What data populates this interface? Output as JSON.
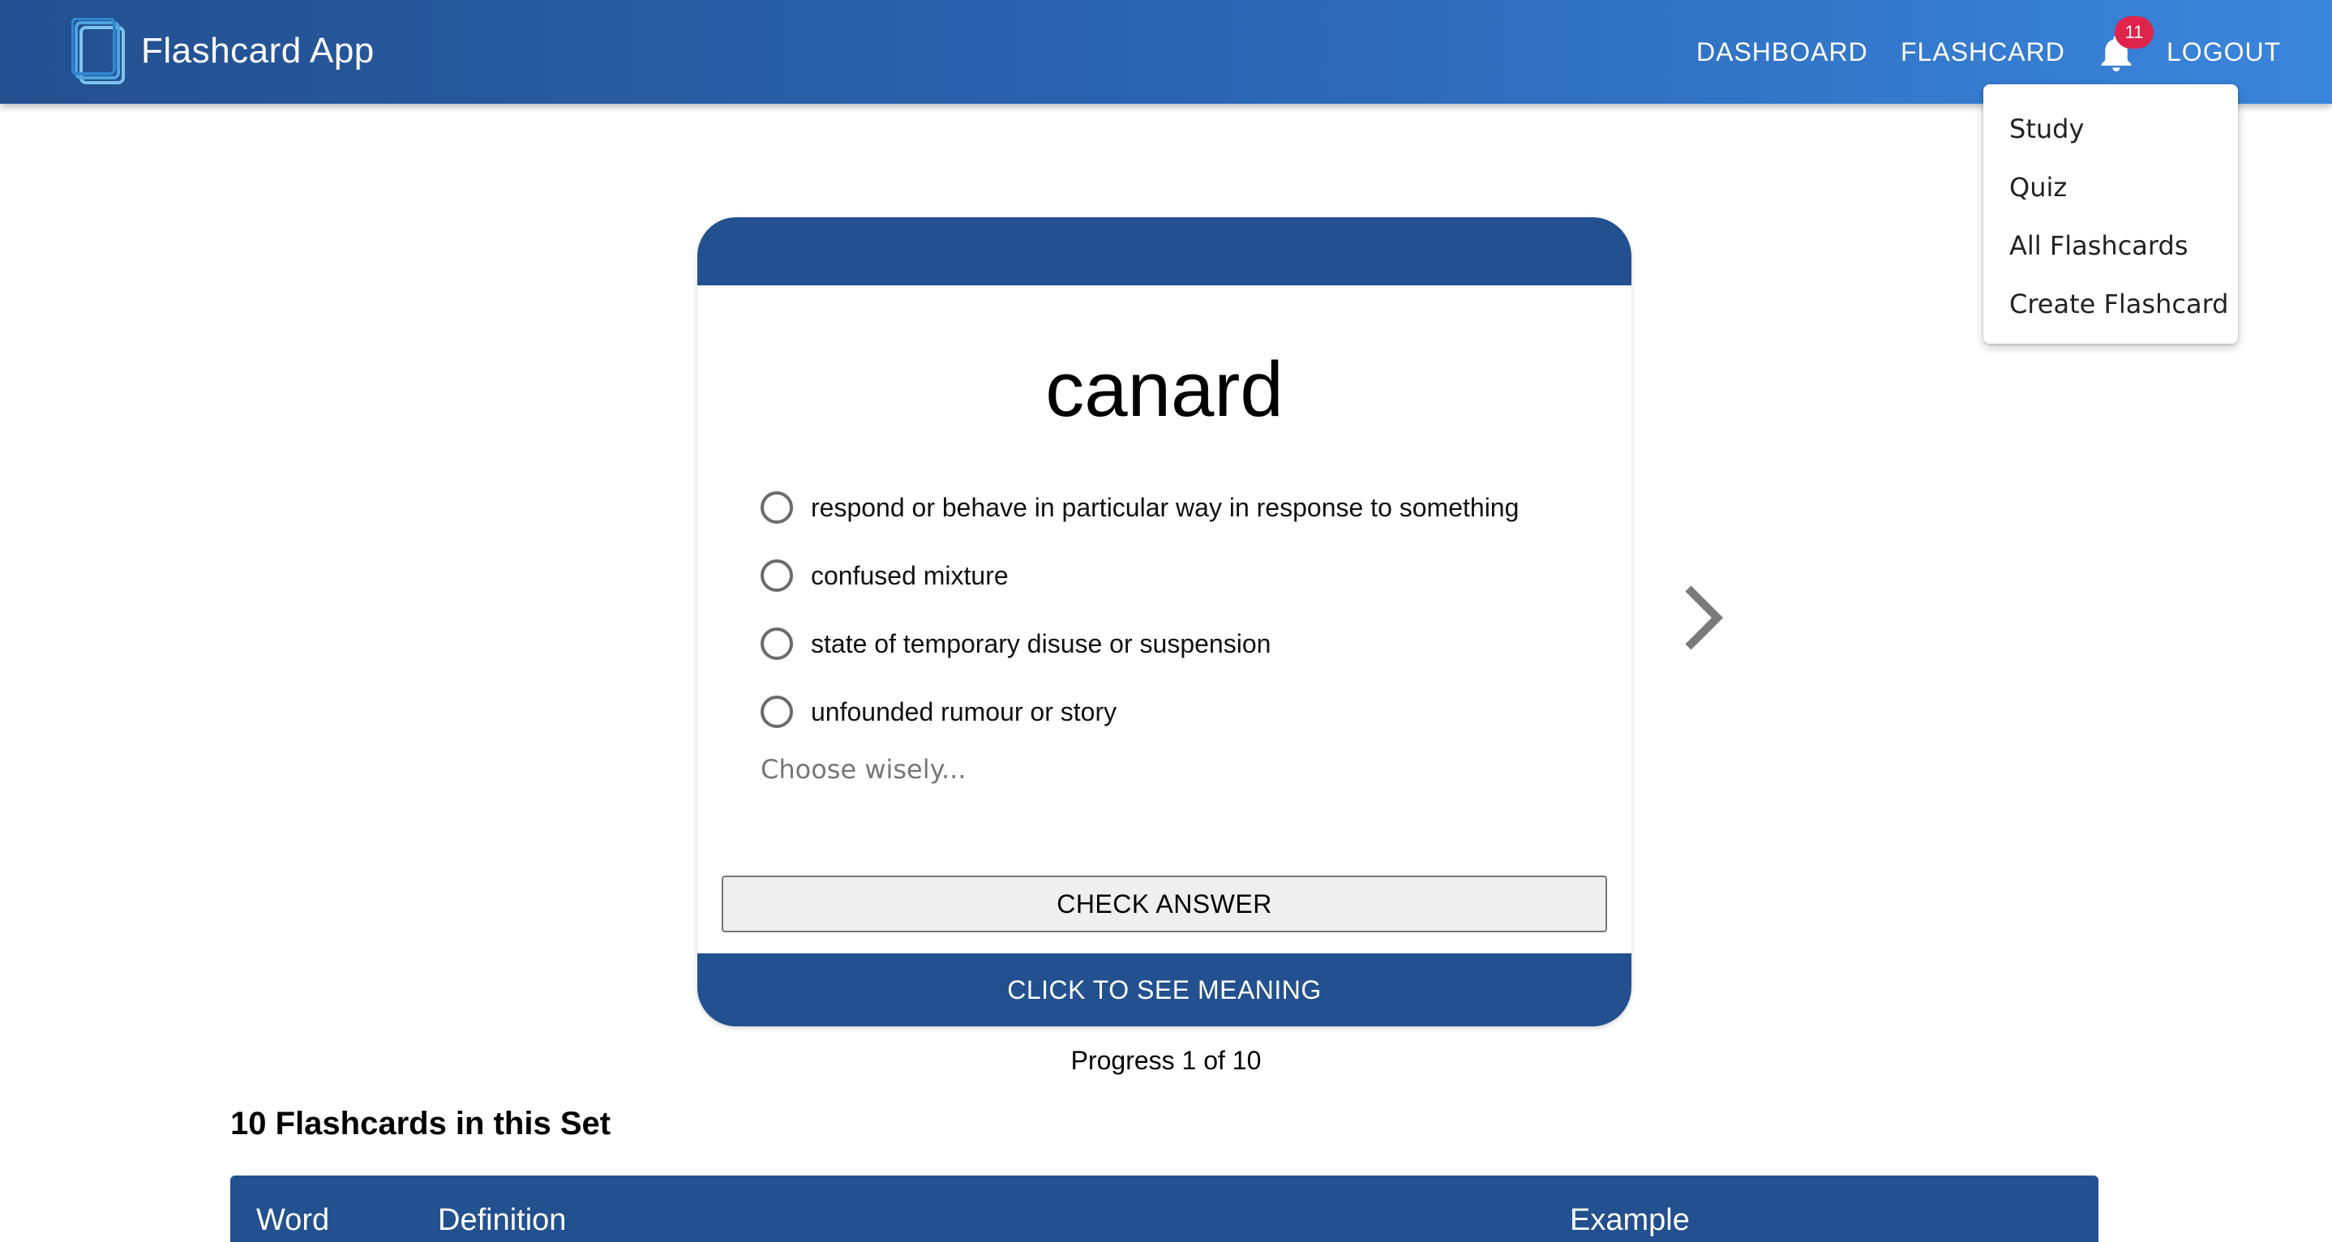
{
  "header": {
    "app_title": "Flashcard App",
    "nav": {
      "dashboard": "DASHBOARD",
      "flashcard": "FLASHCARD",
      "logout": "LOGOUT"
    },
    "notifications_count": "11"
  },
  "flashcard_menu": {
    "items": [
      {
        "label": "Study"
      },
      {
        "label": "Quiz"
      },
      {
        "label": "All Flashcards"
      },
      {
        "label": "Create Flashcard"
      }
    ]
  },
  "card": {
    "word": "canard",
    "options": [
      {
        "label": "respond or behave in particular way in response to something"
      },
      {
        "label": "confused mixture"
      },
      {
        "label": "state of temporary disuse or suspension"
      },
      {
        "label": "unfounded rumour or story"
      }
    ],
    "hint": "Choose wisely...",
    "check_button": "CHECK ANSWER",
    "meaning_button": "CLICK TO SEE MEANING"
  },
  "progress": "Progress 1 of 10",
  "set_title": "10 Flashcards in this Set",
  "table": {
    "columns": [
      "Word",
      "Definition",
      "Example"
    ]
  },
  "colors": {
    "primary": "#23508f",
    "badge": "#e0234a"
  },
  "icons": [
    "flashcards-logo-icon",
    "bell-icon",
    "chevron-right-icon"
  ]
}
